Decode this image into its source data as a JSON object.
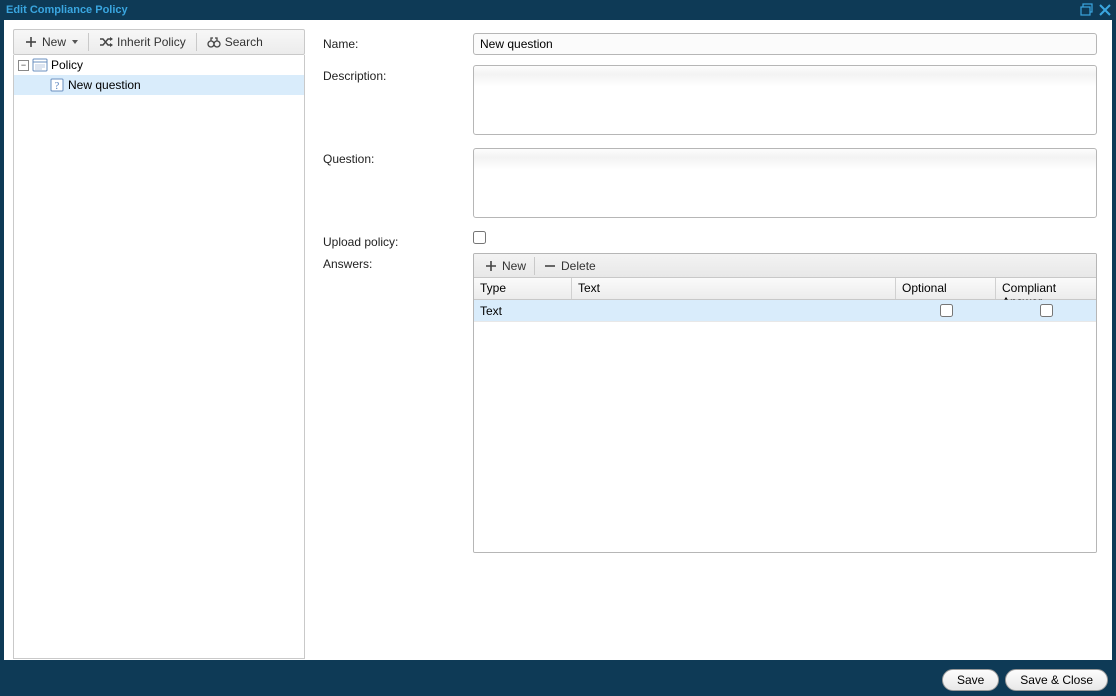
{
  "window": {
    "title": "Edit Compliance Policy"
  },
  "sidebar": {
    "toolbar": {
      "new_label": "New",
      "inherit_label": "Inherit Policy",
      "search_label": "Search"
    },
    "tree": {
      "root": {
        "label": "Policy"
      },
      "child": {
        "label": "New question"
      }
    }
  },
  "form": {
    "name_label": "Name:",
    "name_value": "New question",
    "description_label": "Description:",
    "description_value": "",
    "question_label": "Question:",
    "question_value": "",
    "upload_label": "Upload policy:",
    "upload_checked": false,
    "answers_label": "Answers:"
  },
  "answers": {
    "toolbar": {
      "new_label": "New",
      "delete_label": "Delete"
    },
    "headers": {
      "type": "Type",
      "text": "Text",
      "optional": "Optional",
      "compliant": "Compliant Answer"
    },
    "rows": [
      {
        "type": "Text",
        "text": "",
        "optional": false,
        "compliant": false
      }
    ]
  },
  "footer": {
    "save_label": "Save",
    "save_close_label": "Save & Close"
  }
}
